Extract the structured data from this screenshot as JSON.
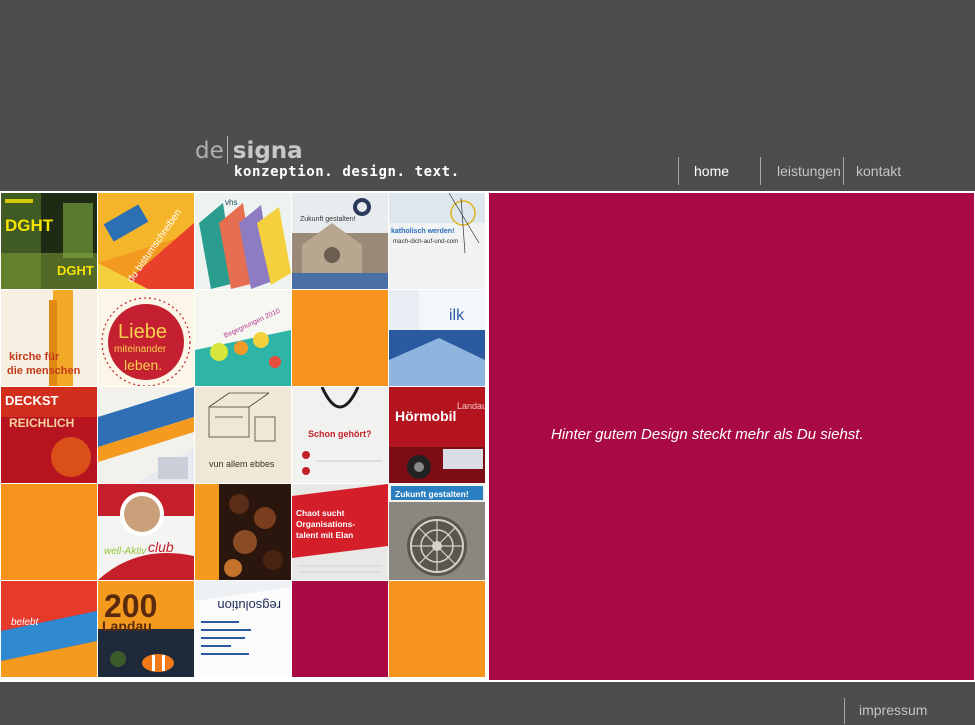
{
  "logo": {
    "part1": "de",
    "part2": "signa",
    "tagline": "konzeption. design. text."
  },
  "nav": {
    "items": [
      {
        "label": "home",
        "active": true
      },
      {
        "label": "leistungen",
        "active": false
      },
      {
        "label": "kontakt",
        "active": false
      }
    ]
  },
  "tiles": [
    {
      "name": "tile-dght-brochure",
      "texts": [
        "DGHT",
        "DGHT"
      ]
    },
    {
      "name": "tile-bistumschreiben",
      "texts": [
        "du bistumschreiben"
      ]
    },
    {
      "name": "tile-vhs-flyers",
      "texts": [
        "vhs"
      ]
    },
    {
      "name": "tile-zukunft-church",
      "texts": [
        "Zukunft gestalten!"
      ]
    },
    {
      "name": "tile-katholisch-werden",
      "texts": [
        "katholisch werden!",
        "mach-dich-auf-und-com"
      ]
    },
    {
      "name": "tile-kirche-fuer-menschen",
      "texts": [
        "kirche für",
        "die menschen"
      ]
    },
    {
      "name": "tile-liebe",
      "texts": [
        "Liebe",
        "miteinander",
        "leben."
      ]
    },
    {
      "name": "tile-begegnungen",
      "texts": [
        "Begegnungen 2010"
      ]
    },
    {
      "name": "tile-orange-1",
      "texts": []
    },
    {
      "name": "tile-ilk",
      "texts": [
        "ilk"
      ]
    },
    {
      "name": "tile-deckst-reichlich",
      "texts": [
        "DECKST",
        "REICHLICH"
      ]
    },
    {
      "name": "tile-blue-stripes",
      "texts": []
    },
    {
      "name": "tile-vun-allem-ebbes",
      "texts": [
        "vun allem ebbes"
      ]
    },
    {
      "name": "tile-schon-gehoert",
      "texts": [
        "Schon gehört?"
      ]
    },
    {
      "name": "tile-hoermobil",
      "texts": [
        "Hörmobil",
        "Landau"
      ]
    },
    {
      "name": "tile-orange-2",
      "texts": []
    },
    {
      "name": "tile-well-aktiv-club",
      "texts": [
        "well-Aktiv",
        "club"
      ]
    },
    {
      "name": "tile-pralinen",
      "texts": []
    },
    {
      "name": "tile-chaot-sucht",
      "texts": [
        "Chaot sucht",
        "Organisations-",
        "talent mit Elan"
      ]
    },
    {
      "name": "tile-zukunft-rosette",
      "texts": [
        "Zukunft gestalten!"
      ]
    },
    {
      "name": "tile-stadt-belebt",
      "texts": [
        "belebt"
      ]
    },
    {
      "name": "tile-landau-zoo",
      "texts": [
        "200",
        "Landau"
      ]
    },
    {
      "name": "tile-regsolution",
      "texts": [
        "regsolution"
      ]
    },
    {
      "name": "tile-magenta",
      "texts": []
    },
    {
      "name": "tile-orange-3",
      "texts": []
    }
  ],
  "main": {
    "tagline": "Hinter gutem Design steckt mehr als Du siehst."
  },
  "footer": {
    "impressum": "impressum"
  },
  "colors": {
    "background": "#4d4d4d",
    "magenta": "#a90a43",
    "orange": "#f7941d",
    "white": "#ffffff"
  }
}
